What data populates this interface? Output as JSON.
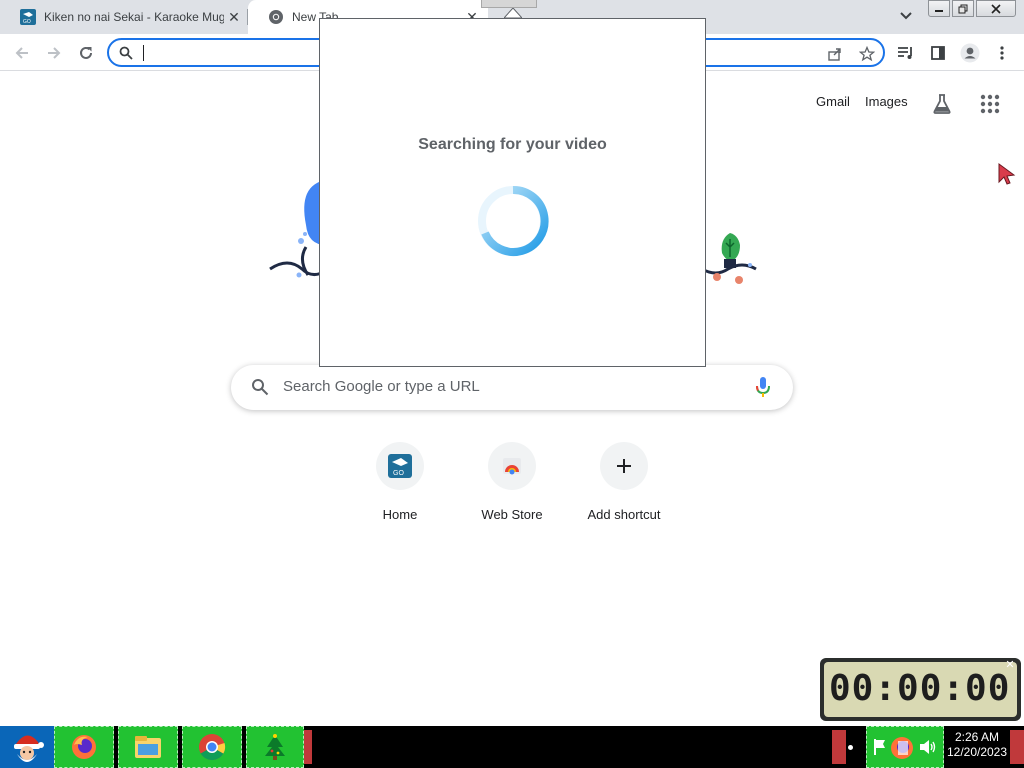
{
  "browser": {
    "tabs": [
      {
        "title": "Kiken no nai Sekai - Karaoke Mug",
        "active": false
      },
      {
        "title": "New Tab",
        "active": true
      }
    ],
    "omnibox": {
      "value": ""
    }
  },
  "ntp": {
    "links": {
      "gmail": "Gmail",
      "images": "Images"
    },
    "search_placeholder": "Search Google or type a URL",
    "shortcuts": [
      {
        "label": "Home"
      },
      {
        "label": "Web Store"
      },
      {
        "label": "Add shortcut"
      }
    ]
  },
  "popup": {
    "title": "Searching for your video"
  },
  "timer": {
    "display": "00:00:00"
  },
  "taskbar": {
    "clock_time": "2:26 AM",
    "clock_date": "12/20/2023"
  },
  "colors": {
    "accent": "#1a73e8",
    "tab_strip": "#dee1e6",
    "taskbar_item": "#22c232"
  }
}
